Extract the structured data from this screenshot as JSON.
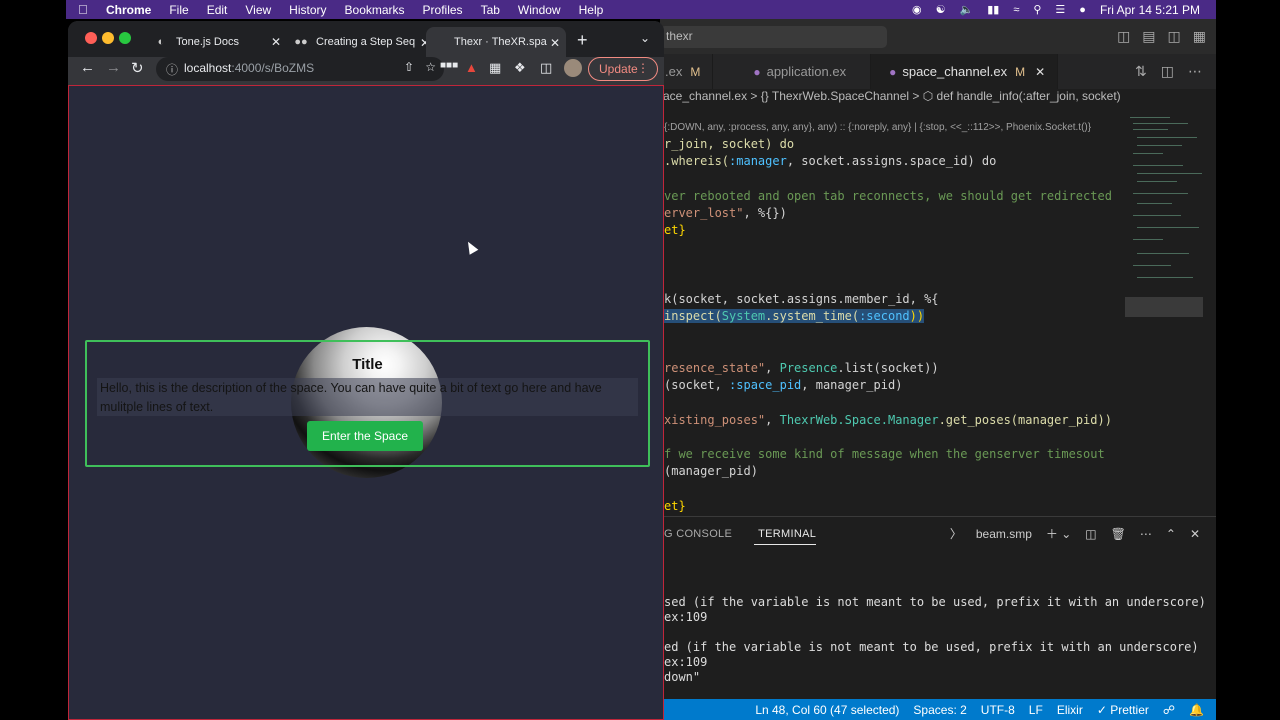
{
  "menubar": {
    "app": "Chrome",
    "items": [
      "File",
      "Edit",
      "View",
      "History",
      "Bookmarks",
      "Profiles",
      "Tab",
      "Window",
      "Help"
    ],
    "clock": "Fri Apr 14  5:21 PM"
  },
  "chrome": {
    "tabs": [
      {
        "label": "Tone.js Docs",
        "icon": "globe-icon"
      },
      {
        "label": "Creating a Step Seq",
        "icon": "medium-icon"
      },
      {
        "label": "Thexr · TheXR.spac",
        "icon": "blank-icon"
      }
    ],
    "url_host": "localhost",
    "url_path": ":4000/s/BoZMS",
    "update_label": "Update"
  },
  "page": {
    "title": "Title",
    "description": "Hello, this is the description of the space. You can have quite a bit of text go here and have mulitple lines of text.",
    "enter_label": "Enter the Space"
  },
  "vscode": {
    "search": "thexr",
    "tabs": [
      {
        "label": ".ex",
        "modified": "M"
      },
      {
        "label": "application.ex",
        "modified": ""
      },
      {
        "label": "space_channel.ex",
        "modified": "M"
      }
    ],
    "breadcrumb": "ace_channel.ex  > {} ThexrWeb.SpaceChannel  > ⬡ def handle_info(:after_join, socket)",
    "code": {
      "spec": "{:DOWN, any, :process, any, any}, any) :: {:noreply, any} | {:stop, <<_::112>>, Phoenix.Socket.t()}",
      "l1": "r_join, socket) do",
      "l2a": ".whereis(",
      "l2b": ":manager",
      "l2c": ", socket.assigns.space_id) do",
      "l3": "ver rebooted and open tab reconnects, we should get redirected",
      "l4a": "erver_lost\"",
      "l4b": ", %{})",
      "l5": "et}",
      "l6a": "k(socket, socket.assigns.member_id, %{",
      "l7a": "inspect(",
      "l7b": "System",
      "l7c": ".system_time(",
      "l7d": ":second",
      "l7e": "))",
      "l8a": "resence_state\"",
      "l8b": ", ",
      "l8c": "Presence",
      "l8d": ".list(socket))",
      "l9a": "(socket, ",
      "l9b": ":space_pid",
      "l9c": ", manager_pid)",
      "l10a": "xisting_poses\"",
      "l10b": ", ",
      "l10c": "ThexrWeb.Space.Manager",
      "l10d": ".get_poses(manager_pid))",
      "l11": "f we receive some kind of message when the genserver timesout",
      "l12": "(manager_pid)",
      "l13": "et}"
    },
    "panel": {
      "tabs": [
        "G CONSOLE",
        "TERMINAL"
      ],
      "shell": "beam.smp",
      "lines": [
        "sed (if the variable is not meant to be used, prefix it with an underscore)",
        "ex:109",
        "ed (if the variable is not meant to be used, prefix it with an underscore)",
        "ex:109",
        "down\""
      ]
    },
    "status": {
      "position": "Ln 48, Col 60 (47 selected)",
      "spaces": "Spaces: 2",
      "encoding": "UTF-8",
      "eol": "LF",
      "language": "Elixir",
      "formatter": "✓ Prettier"
    }
  }
}
